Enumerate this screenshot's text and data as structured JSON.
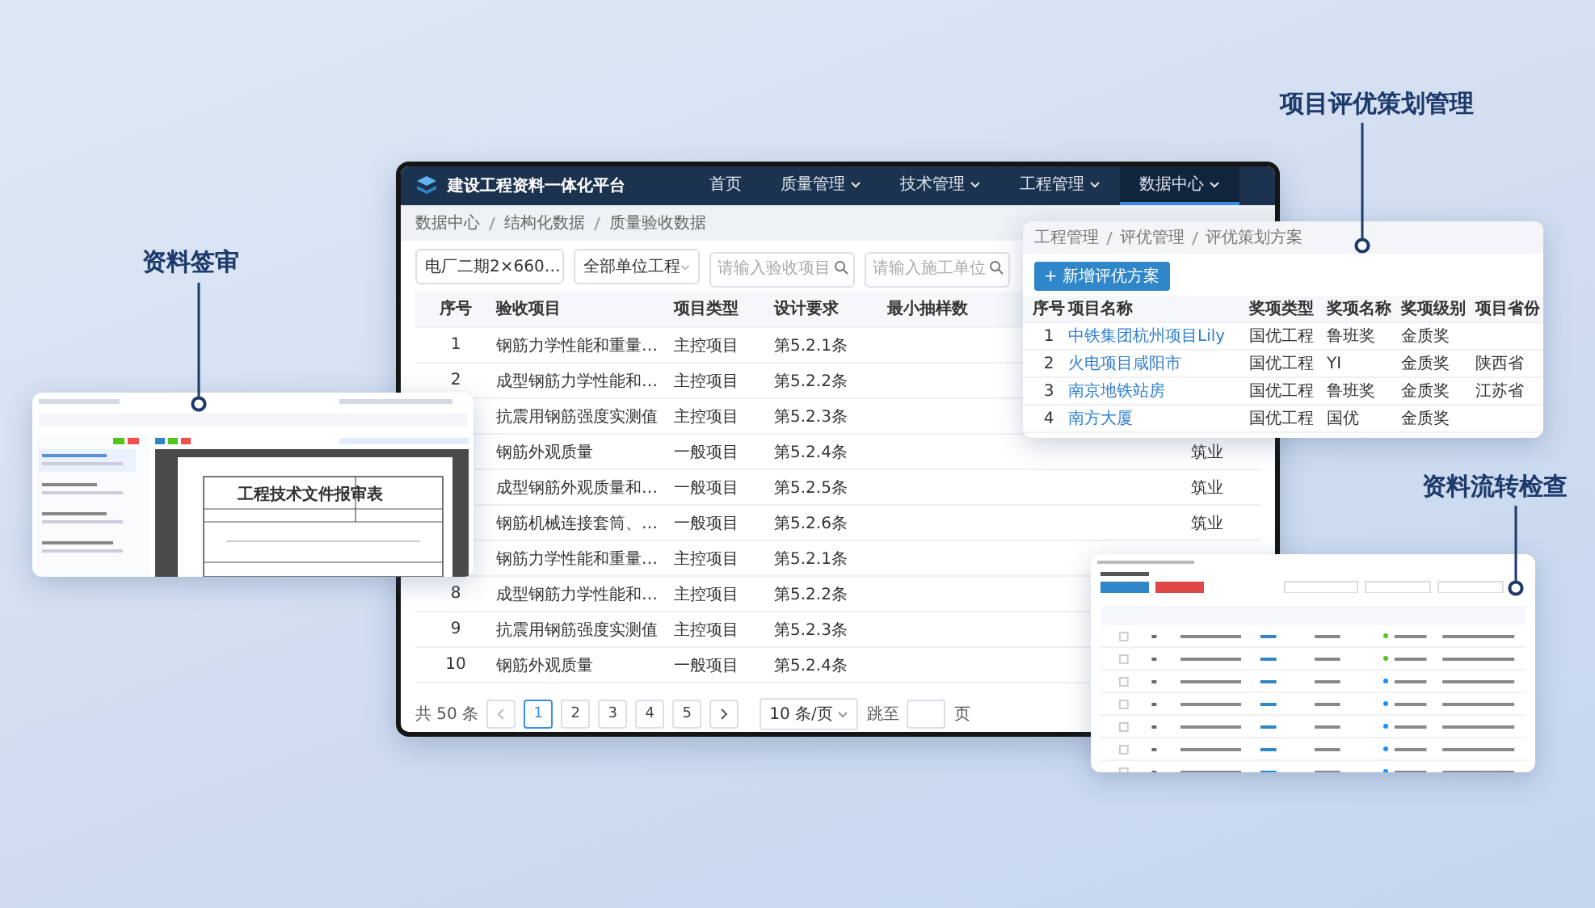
{
  "labels": [
    {
      "text": "资料签审"
    },
    {
      "text": "项目评优策划管理"
    },
    {
      "text": "资料流转检查"
    }
  ],
  "main_window": {
    "title": "建设工程资料一体化平台",
    "nav": [
      {
        "label": "首页",
        "dropdown": false,
        "selected": false
      },
      {
        "label": "质量管理",
        "dropdown": true,
        "selected": false
      },
      {
        "label": "技术管理",
        "dropdown": true,
        "selected": false
      },
      {
        "label": "工程管理",
        "dropdown": true,
        "selected": false
      },
      {
        "label": "数据中心",
        "dropdown": true,
        "selected": true
      }
    ],
    "breadcrumb": [
      "数据中心",
      "结构化数据",
      "质量验收数据"
    ],
    "filters": [
      {
        "kind": "select",
        "value": "电厂二期2×660…"
      },
      {
        "kind": "select",
        "value": "全部单位工程"
      },
      {
        "kind": "search",
        "placeholder": "请输入验收项目"
      },
      {
        "kind": "search",
        "placeholder": "请输入施工单位"
      }
    ],
    "table": {
      "columns": [
        "序号",
        "验收项目",
        "项目类型",
        "设计要求",
        "最小抽样数"
      ],
      "rows": [
        {
          "seq": "1",
          "item": "钢筋力学性能和重量…",
          "type": "主控项目",
          "requirement": "第5.2.1条"
        },
        {
          "seq": "2",
          "item": "成型钢筋力学性能和…",
          "type": "主控项目",
          "requirement": "第5.2.2条"
        },
        {
          "item": "抗震用钢筋强度实测值",
          "type": "主控项目",
          "requirement": "第5.2.3条"
        },
        {
          "item": "钢筋外观质量",
          "type": "一般项目",
          "requirement": "第5.2.4条",
          "column_6": "筑业"
        },
        {
          "item": "成型钢筋外观质量和…",
          "type": "一般项目",
          "requirement": "第5.2.5条",
          "column_6": "筑业"
        },
        {
          "item": "钢筋机械连接套筒、…",
          "type": "一般项目",
          "requirement": "第5.2.6条",
          "column_6": "筑业"
        },
        {
          "item": "钢筋力学性能和重量…",
          "type": "主控项目",
          "requirement": "第5.2.1条"
        },
        {
          "seq": "8",
          "item": "成型钢筋力学性能和…",
          "type": "主控项目",
          "requirement": "第5.2.2条"
        },
        {
          "seq": "9",
          "item": "抗震用钢筋强度实测值",
          "type": "主控项目",
          "requirement": "第5.2.3条"
        },
        {
          "seq": "10",
          "item": "钢筋外观质量",
          "type": "一般项目",
          "requirement": "第5.2.4条"
        }
      ]
    },
    "pagination": {
      "total": "共 50 条",
      "pages": [
        {
          "label": "1",
          "selected": true
        },
        {
          "label": "2",
          "selected": false
        },
        {
          "label": "3",
          "selected": false
        },
        {
          "label": "4",
          "selected": false
        },
        {
          "label": "5",
          "selected": false
        }
      ],
      "page_size": "10 条/页",
      "jump_label": "跳至",
      "jump_suffix": "页"
    }
  },
  "award_card": {
    "breadcrumb": [
      "工程管理",
      "评优管理",
      "评优策划方案"
    ],
    "add_button": "+ 新增评优方案",
    "columns": [
      "序号",
      "项目名称",
      "奖项类型",
      "奖项名称",
      "奖项级别",
      "项目省份"
    ],
    "rows": [
      {
        "seq": "1",
        "name": "中铁集团杭州项目Lily",
        "award_type": "国优工程",
        "award_name": "鲁班奖",
        "level": "金质奖"
      },
      {
        "seq": "2",
        "name": "火电项目咸阳市",
        "award_type": "国优工程",
        "award_name": "YI",
        "level": "金质奖",
        "province": "陕西省"
      },
      {
        "seq": "3",
        "name": "南京地铁站房",
        "award_type": "国优工程",
        "award_name": "鲁班奖",
        "level": "金质奖",
        "province": "江苏省"
      },
      {
        "seq": "4",
        "name": "南方大厦",
        "award_type": "国优工程",
        "award_name": "国优",
        "level": "金质奖"
      }
    ]
  },
  "review_card": {
    "document_title": "工程技术文件报审表"
  },
  "flow_card": {
    "rows": [
      {
        "color": "#52c41a"
      },
      {
        "color": "#52c41a"
      },
      {
        "color": "#1890ff"
      },
      {
        "color": "#1890ff"
      },
      {
        "color": "#1890ff"
      },
      {
        "color": "#1890ff"
      },
      {
        "color": "#1890ff"
      }
    ]
  }
}
